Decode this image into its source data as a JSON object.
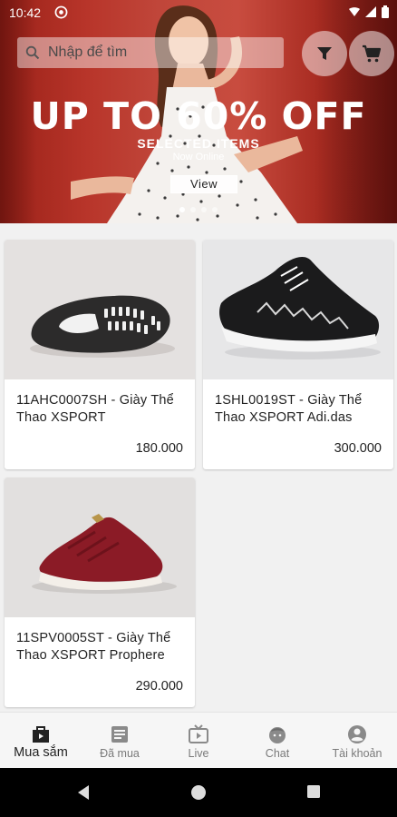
{
  "status_bar": {
    "time": "10:42"
  },
  "search": {
    "placeholder": "Nhập để tìm"
  },
  "banner": {
    "headline": "UP TO 60% OFF",
    "subline": "SELECTED ITEMS",
    "tagline": "Now Online",
    "view_label": "View",
    "slide_count": 4,
    "active_slide": 1
  },
  "products": [
    {
      "name": "11AHC0007SH - Giày Thể Thao XSPORT",
      "price": "180.000"
    },
    {
      "name": "1SHL0019ST - Giày Thể Thao XSPORT Adi.das",
      "price": "300.000"
    },
    {
      "name": "11SPV0005ST - Giày Thể Thao XSPORT Prophere",
      "price": "290.000"
    }
  ],
  "bottom_nav": [
    {
      "label": "Mua sắm",
      "icon": "shopping-bag-icon",
      "active": true
    },
    {
      "label": "Đã mua",
      "icon": "receipt-icon",
      "active": false
    },
    {
      "label": "Live",
      "icon": "live-tv-icon",
      "active": false
    },
    {
      "label": "Chat",
      "icon": "chat-face-icon",
      "active": false
    },
    {
      "label": "Tài khoản",
      "icon": "account-icon",
      "active": false
    }
  ],
  "colors": {
    "banner_red": "#b8352a",
    "nav_active": "#222222",
    "nav_inactive": "#7a7a7a"
  }
}
